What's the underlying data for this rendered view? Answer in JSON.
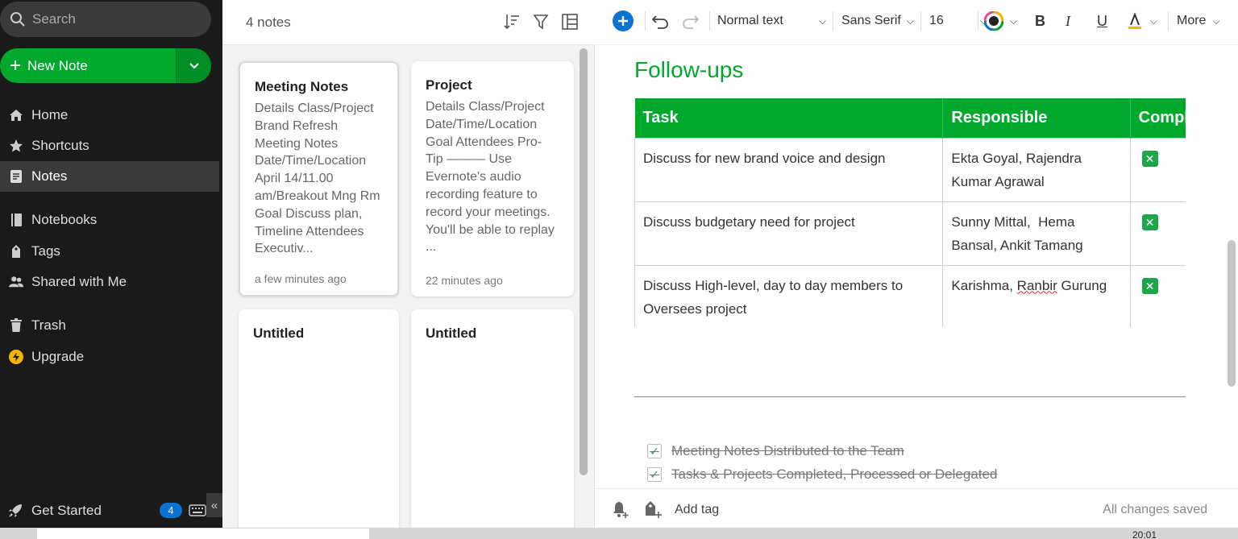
{
  "sidebar": {
    "search_placeholder": "Search",
    "new_note_label": "New Note",
    "nav": [
      {
        "label": "Home",
        "icon": "home-icon"
      },
      {
        "label": "Shortcuts",
        "icon": "star-icon"
      },
      {
        "label": "Notes",
        "icon": "note-icon"
      },
      {
        "label": "Notebooks",
        "icon": "notebook-icon"
      },
      {
        "label": "Tags",
        "icon": "tag-icon"
      },
      {
        "label": "Shared with Me",
        "icon": "people-icon"
      },
      {
        "label": "Trash",
        "icon": "trash-icon"
      },
      {
        "label": "Upgrade",
        "icon": "upgrade-icon"
      }
    ],
    "get_started_label": "Get Started",
    "get_started_badge": "4"
  },
  "notelist": {
    "count": "4 notes",
    "notes": [
      {
        "title": "Meeting Notes",
        "body": "Details Class/Project Brand Refresh Meeting Notes Date/Time/Location April 14/11.00 am/Breakout Mng Rm Goal Discuss plan, Timeline Attendees Executiv...",
        "date": "a few minutes ago"
      },
      {
        "title": "Project",
        "body": "Details Class/Project Date/Time/Location Goal Attendees Pro-Tip ——— Use Evernote's audio recording feature to record your meetings. You'll be able to replay ...",
        "date": "22 minutes ago"
      },
      {
        "title": "Untitled",
        "body": "",
        "date": ""
      },
      {
        "title": "Untitled",
        "body": "",
        "date": ""
      }
    ]
  },
  "toolbar": {
    "style": "Normal text",
    "font": "Sans Serif",
    "size": "16",
    "more": "More"
  },
  "editor": {
    "heading": "Follow-ups",
    "table": {
      "headers": [
        "Task",
        "Responsible",
        "Completed"
      ],
      "rows": [
        {
          "task": "Discuss for new brand voice and design",
          "responsible": "Ekta Goyal, Rajendra Kumar Agrawal",
          "done": true
        },
        {
          "task": "Discuss budgetary need for project",
          "responsible": "Sunny Mittal,  Hema Bansal, Ankit Tamang",
          "done": true
        },
        {
          "task": "Discuss High-level, day to day members to Oversees project",
          "responsible_a": "Karishma, ",
          "responsible_b": "Ranbir",
          "responsible_c": " Gurung",
          "done": true
        }
      ]
    },
    "checklist": [
      "Meeting Notes Distributed to the Team",
      "Tasks & Projects Completed, Processed or Delegated"
    ]
  },
  "footer": {
    "add_tag": "Add tag",
    "status": "All changes saved"
  },
  "taskbar": {
    "clock": "20:01"
  },
  "colors": {
    "accent": "#00a82d",
    "sidebar_bg": "#1a1a1a",
    "badge": "#0b73d0"
  }
}
